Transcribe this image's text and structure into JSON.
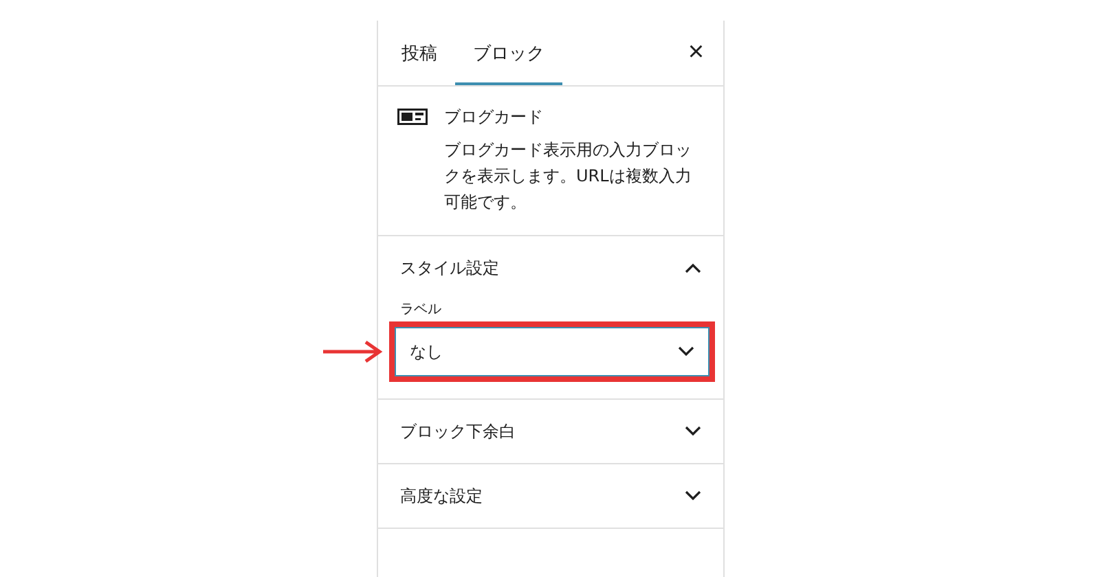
{
  "tabs": [
    {
      "label": "投稿",
      "selected": false
    },
    {
      "label": "ブロック",
      "selected": true
    }
  ],
  "close_label": "×",
  "block": {
    "title": "ブログカード",
    "description": "ブログカード表示用の入力ブロックを表示します。URLは複数入力可能です。"
  },
  "panels": [
    {
      "title": "スタイル設定",
      "expanded": true,
      "field": {
        "label": "ラベル",
        "value": "なし",
        "highlighted": true
      }
    },
    {
      "title": "ブロック下余白",
      "expanded": false
    },
    {
      "title": "高度な設定",
      "expanded": false
    }
  ]
}
